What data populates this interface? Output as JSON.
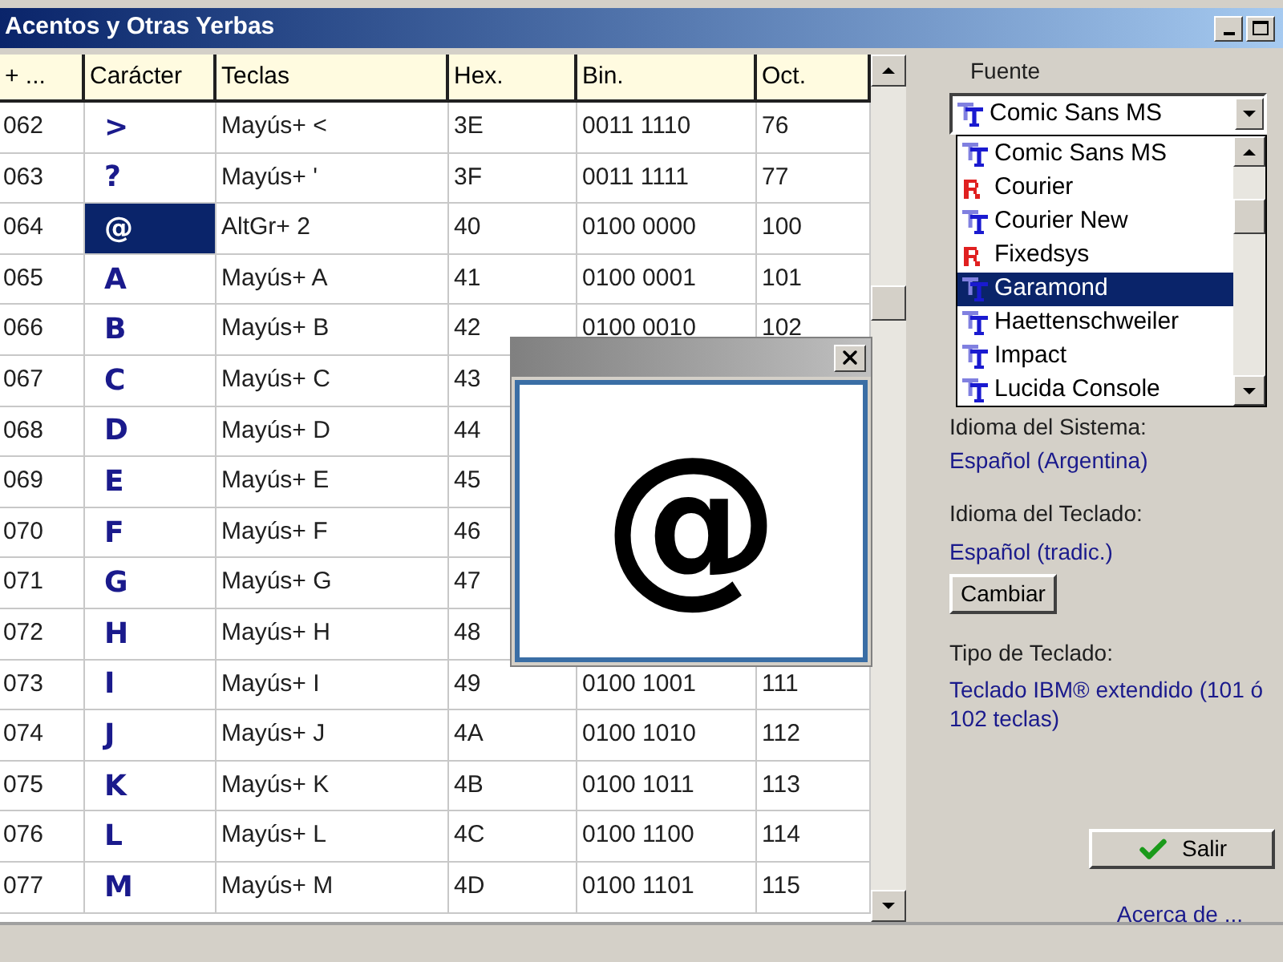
{
  "window": {
    "title": "Acentos y Otras Yerbas"
  },
  "table": {
    "columns": [
      "+ ...",
      "Carácter",
      "Teclas",
      "Hex.",
      "Bin.",
      "Oct."
    ],
    "rows": [
      {
        "cells": [
          "062",
          ">",
          "Mayús+ <",
          "3E",
          "0011 1110",
          "76"
        ],
        "selected": false
      },
      {
        "cells": [
          "063",
          "?",
          "Mayús+ '",
          "3F",
          "0011 1111",
          "77"
        ],
        "selected": false
      },
      {
        "cells": [
          "064",
          "@",
          "AltGr+ 2",
          "40",
          "0100 0000",
          "100"
        ],
        "selected": true
      },
      {
        "cells": [
          "065",
          "A",
          "Mayús+ A",
          "41",
          "0100 0001",
          "101"
        ],
        "selected": false
      },
      {
        "cells": [
          "066",
          "B",
          "Mayús+ B",
          "42",
          "0100 0010",
          "102"
        ],
        "selected": false
      },
      {
        "cells": [
          "067",
          "C",
          "Mayús+ C",
          "43"
        ],
        "selected": false
      },
      {
        "cells": [
          "068",
          "D",
          "Mayús+ D",
          "44"
        ],
        "selected": false
      },
      {
        "cells": [
          "069",
          "E",
          "Mayús+ E",
          "45"
        ],
        "selected": false
      },
      {
        "cells": [
          "070",
          "F",
          "Mayús+ F",
          "46"
        ],
        "selected": false
      },
      {
        "cells": [
          "071",
          "G",
          "Mayús+ G",
          "47"
        ],
        "selected": false
      },
      {
        "cells": [
          "072",
          "H",
          "Mayús+ H",
          "48"
        ],
        "selected": false
      },
      {
        "cells": [
          "073",
          "I",
          "Mayús+ I",
          "49",
          "0100 1001",
          "111"
        ],
        "selected": false
      },
      {
        "cells": [
          "074",
          "J",
          "Mayús+ J",
          "4A",
          "0100 1010",
          "112"
        ],
        "selected": false
      },
      {
        "cells": [
          "075",
          "K",
          "Mayús+ K",
          "4B",
          "0100 1011",
          "113"
        ],
        "selected": false
      },
      {
        "cells": [
          "076",
          "L",
          "Mayús+ L",
          "4C",
          "0100 1100",
          "114"
        ],
        "selected": false
      },
      {
        "cells": [
          "077",
          "M",
          "Mayús+ M",
          "4D",
          "0100 1101",
          "115"
        ],
        "selected": false
      }
    ]
  },
  "preview": {
    "character": "@"
  },
  "font": {
    "label": "Fuente",
    "current": {
      "label": "Comic Sans MS",
      "kind": "truetype"
    },
    "options": [
      {
        "label": "Comic Sans MS",
        "kind": "truetype",
        "selected": false
      },
      {
        "label": "Courier",
        "kind": "raster",
        "selected": false
      },
      {
        "label": "Courier New",
        "kind": "truetype",
        "selected": false
      },
      {
        "label": "Fixedsys",
        "kind": "raster",
        "selected": false
      },
      {
        "label": "Garamond",
        "kind": "truetype",
        "selected": true
      },
      {
        "label": "Haettenschweiler",
        "kind": "truetype",
        "selected": false
      },
      {
        "label": "Impact",
        "kind": "truetype",
        "selected": false
      },
      {
        "label": "Lucida Console",
        "kind": "truetype",
        "selected": false
      }
    ]
  },
  "system_language": {
    "label": "Idioma del Sistema:",
    "value": "Español (Argentina)"
  },
  "keyboard_language": {
    "label": "Idioma del Teclado:",
    "value": "Español (tradic.)",
    "button": "Cambiar"
  },
  "keyboard_type": {
    "label": "Tipo de Teclado:",
    "value": "Teclado IBM® extendido (101 ó 102 teclas)"
  },
  "exit_button": "Salir",
  "about_link": "Acerca de ..."
}
